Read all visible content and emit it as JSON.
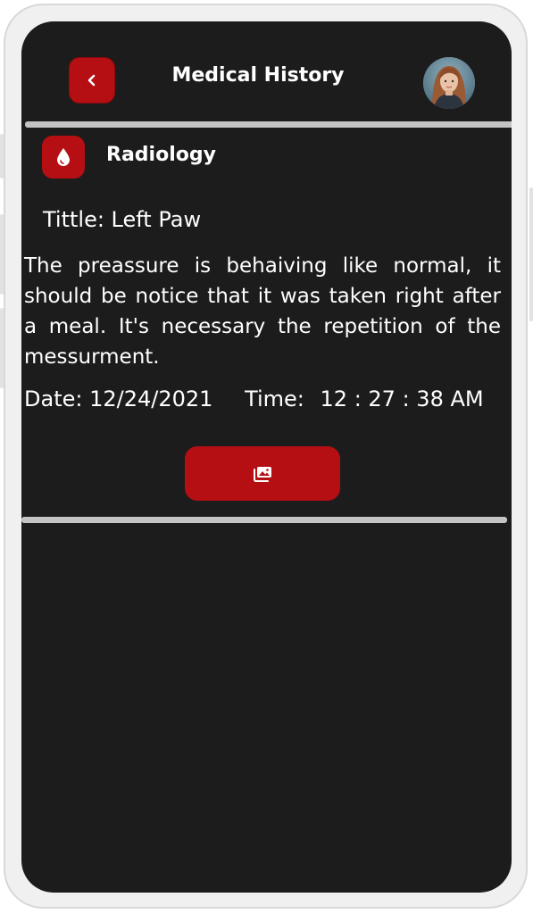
{
  "header": {
    "title": "Medical History",
    "back_icon": "chevron-left-icon",
    "avatar": "user-avatar"
  },
  "record": {
    "category_icon": "blood-drop-icon",
    "category": "Radiology",
    "title_label": "Tittle: Left Paw",
    "description": "The preassure is behaiving like normal, it should be notice that it was taken right after a meal. It's necessary the repetition of the messurment.",
    "date_label": "Date:",
    "date": "12/24/2021",
    "time_label": "Time:",
    "time": "12 : 27 : 38 AM"
  },
  "actions": {
    "gallery_icon": "photo-gallery-icon"
  },
  "colors": {
    "accent": "#b50f13",
    "screen_bg": "#1c1c1c",
    "divider": "#c4c4c4",
    "text": "#ffffff"
  }
}
